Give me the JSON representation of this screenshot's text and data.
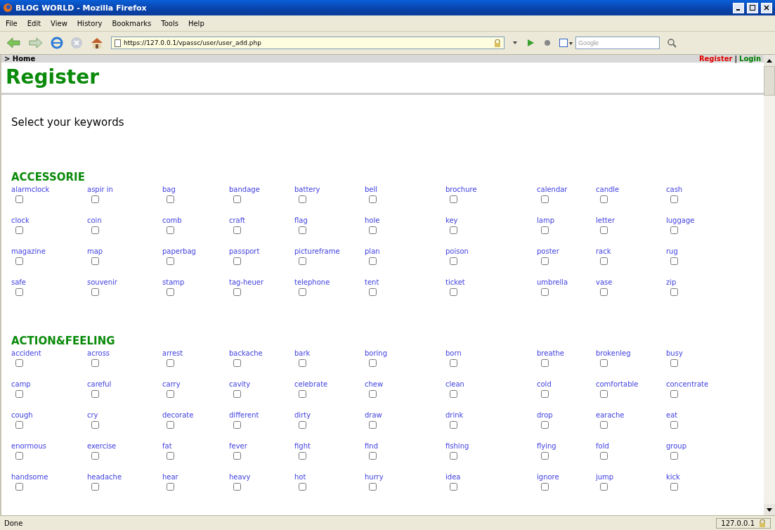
{
  "window": {
    "title": "BLOG WORLD - Mozilla Firefox"
  },
  "menu": [
    "File",
    "Edit",
    "View",
    "History",
    "Bookmarks",
    "Tools",
    "Help"
  ],
  "toolbar": {
    "url": "https://127.0.0.1/vpassc/user/user_add.php",
    "search_placeholder": "Google"
  },
  "breadcrumb": "> Home",
  "account_links": [
    {
      "label": "Register",
      "kind": "active"
    },
    {
      "label": "|",
      "kind": "separator"
    },
    {
      "label": "Login",
      "kind": "link"
    }
  ],
  "heading": "Register",
  "prompt": "Select your keywords",
  "categories": [
    {
      "title": "ACCESSORIE",
      "items": [
        {
          "label": "alarmclock",
          "checked": false
        },
        {
          "label": "aspir in",
          "checked": false
        },
        {
          "label": "bag",
          "checked": false
        },
        {
          "label": "bandage",
          "checked": false
        },
        {
          "label": "battery",
          "checked": false
        },
        {
          "label": "bell",
          "checked": false
        },
        {
          "label": "brochure",
          "checked": false
        },
        {
          "label": "calendar",
          "checked": false
        },
        {
          "label": "candle",
          "checked": false
        },
        {
          "label": "cash",
          "checked": false
        },
        {
          "label": "clock",
          "checked": false
        },
        {
          "label": "coin",
          "checked": false
        },
        {
          "label": "comb",
          "checked": false
        },
        {
          "label": "craft",
          "checked": false
        },
        {
          "label": "flag",
          "checked": false
        },
        {
          "label": "hole",
          "checked": false
        },
        {
          "label": "key",
          "checked": false
        },
        {
          "label": "lamp",
          "checked": false
        },
        {
          "label": "letter",
          "checked": false
        },
        {
          "label": "luggage",
          "checked": false
        },
        {
          "label": "magazine",
          "checked": false
        },
        {
          "label": "map",
          "checked": false
        },
        {
          "label": "paperbag",
          "checked": false
        },
        {
          "label": "passport",
          "checked": false
        },
        {
          "label": "pictureframe",
          "checked": false
        },
        {
          "label": "plan",
          "checked": false
        },
        {
          "label": "poison",
          "checked": false
        },
        {
          "label": "poster",
          "checked": false
        },
        {
          "label": "rack",
          "checked": false
        },
        {
          "label": "rug",
          "checked": false
        },
        {
          "label": "safe",
          "checked": false
        },
        {
          "label": "souvenir",
          "checked": false
        },
        {
          "label": "stamp",
          "checked": false
        },
        {
          "label": "tag-heuer",
          "checked": false
        },
        {
          "label": "telephone",
          "checked": false
        },
        {
          "label": "tent",
          "checked": false
        },
        {
          "label": "ticket",
          "checked": false
        },
        {
          "label": "umbrella",
          "checked": false
        },
        {
          "label": "vase",
          "checked": false
        },
        {
          "label": "zip",
          "checked": false
        }
      ]
    },
    {
      "title": "ACTION&FEELING",
      "items": [
        {
          "label": "accident",
          "checked": false
        },
        {
          "label": "across",
          "checked": false
        },
        {
          "label": "arrest",
          "checked": false
        },
        {
          "label": "backache",
          "checked": false
        },
        {
          "label": "bark",
          "checked": false
        },
        {
          "label": "boring",
          "checked": false
        },
        {
          "label": "born",
          "checked": false
        },
        {
          "label": "breathe",
          "checked": false
        },
        {
          "label": "brokenleg",
          "checked": false
        },
        {
          "label": "busy",
          "checked": false
        },
        {
          "label": "camp",
          "checked": false
        },
        {
          "label": "careful",
          "checked": false
        },
        {
          "label": "carry",
          "checked": false
        },
        {
          "label": "cavity",
          "checked": false
        },
        {
          "label": "celebrate",
          "checked": false
        },
        {
          "label": "chew",
          "checked": false
        },
        {
          "label": "clean",
          "checked": false
        },
        {
          "label": "cold",
          "checked": false
        },
        {
          "label": "comfortable",
          "checked": false
        },
        {
          "label": "concentrate",
          "checked": false
        },
        {
          "label": "cough",
          "checked": false
        },
        {
          "label": "cry",
          "checked": false
        },
        {
          "label": "decorate",
          "checked": false
        },
        {
          "label": "different",
          "checked": false
        },
        {
          "label": "dirty",
          "checked": false
        },
        {
          "label": "draw",
          "checked": false
        },
        {
          "label": "drink",
          "checked": false
        },
        {
          "label": "drop",
          "checked": false
        },
        {
          "label": "earache",
          "checked": false
        },
        {
          "label": "eat",
          "checked": false
        },
        {
          "label": "enormous",
          "checked": false
        },
        {
          "label": "exercise",
          "checked": false
        },
        {
          "label": "fat",
          "checked": false
        },
        {
          "label": "fever",
          "checked": false
        },
        {
          "label": "fight",
          "checked": false
        },
        {
          "label": "find",
          "checked": false
        },
        {
          "label": "fishing",
          "checked": false
        },
        {
          "label": "flying",
          "checked": false
        },
        {
          "label": "fold",
          "checked": false
        },
        {
          "label": "group",
          "checked": false
        },
        {
          "label": "handsome",
          "checked": false
        },
        {
          "label": "headache",
          "checked": false
        },
        {
          "label": "hear",
          "checked": false
        },
        {
          "label": "heavy",
          "checked": false
        },
        {
          "label": "hot",
          "checked": false
        },
        {
          "label": "hurry",
          "checked": false
        },
        {
          "label": "idea",
          "checked": false
        },
        {
          "label": "ignore",
          "checked": false
        },
        {
          "label": "jump",
          "checked": false
        },
        {
          "label": "kick",
          "checked": false
        }
      ]
    }
  ],
  "status_bar": {
    "text": "Done",
    "host": "127.0.0.1"
  }
}
